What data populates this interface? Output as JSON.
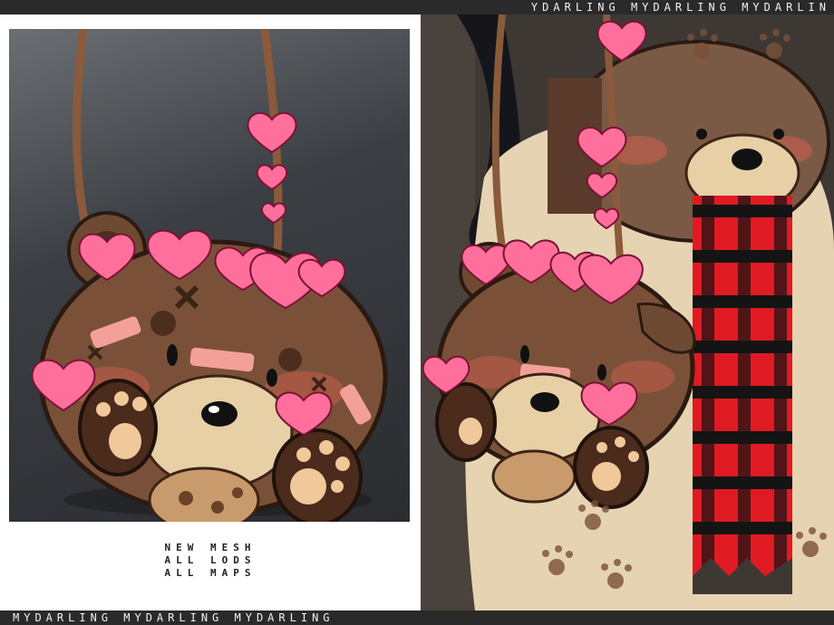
{
  "banners": {
    "top": "YDARLING  MYDARLING  MYDARLIN",
    "bottom": "MYDARLING  MYDARLING  MYDARLING"
  },
  "captions": [
    "NEW MESH",
    "ALL LODS",
    "ALL MAPS"
  ],
  "colors": {
    "bear_brown": "#7a5138",
    "muzzle": "#e7cfa6",
    "heart_pink": "#ff6f9c",
    "plaid_red": "#e01a22",
    "strap": "#8a5a3a"
  }
}
